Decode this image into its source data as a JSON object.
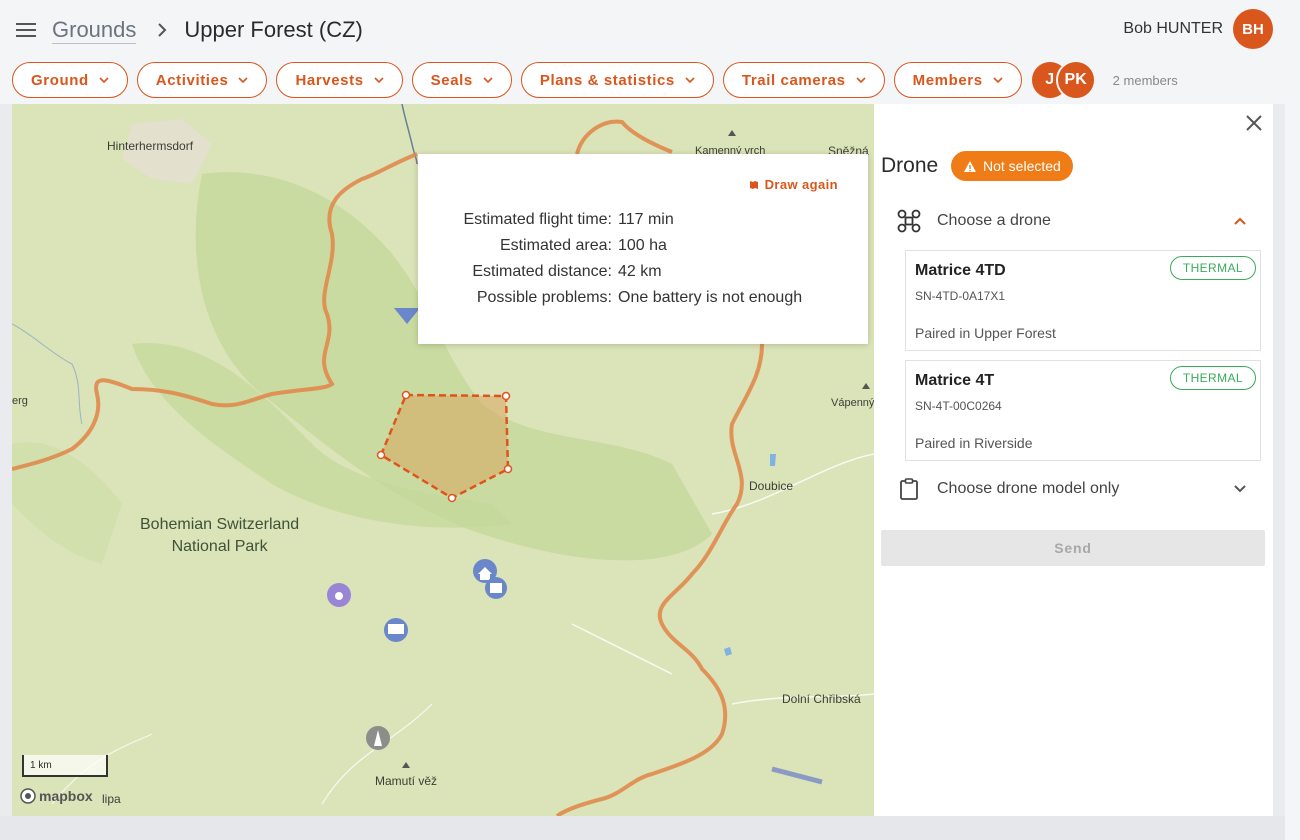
{
  "header": {
    "breadcrumb_root": "Grounds",
    "breadcrumb_current": "Upper Forest (CZ)",
    "user_name": "Bob HUNTER",
    "user_initials": "BH"
  },
  "nav": {
    "items": [
      {
        "label": "Ground"
      },
      {
        "label": "Activities"
      },
      {
        "label": "Harvests"
      },
      {
        "label": "Seals"
      },
      {
        "label": "Plans & statistics"
      },
      {
        "label": "Trail cameras"
      },
      {
        "label": "Members"
      }
    ],
    "member_initials": [
      "J",
      "PK"
    ],
    "members_count": "2 members"
  },
  "map": {
    "labels": {
      "hinterhermsdorf": "Hinterhermsdorf",
      "kamenny": "Kamenný vrch",
      "snezna": "Sněžná",
      "erg": "erg",
      "vapenny": "Vápenný",
      "doubice": "Doubice",
      "dolni": "Dolní Chřibská",
      "mamuti": "Mamutí věž",
      "lipa": "lipa"
    },
    "park_label_line1": "Bohemian Switzerland",
    "park_label_line2": "National Park",
    "scale_label": "1 km",
    "attribution": "mapbox"
  },
  "estimate": {
    "draw_again_label": "Draw again",
    "rows": [
      {
        "key": "Estimated flight time:",
        "value": "117 min"
      },
      {
        "key": "Estimated area:",
        "value": "100 ha"
      },
      {
        "key": "Estimated distance:",
        "value": "42 km"
      },
      {
        "key": "Possible problems:",
        "value": "One battery is not enough"
      }
    ]
  },
  "panel": {
    "title": "Drone",
    "status": "Not selected",
    "choose_drone_label": "Choose a drone",
    "drones": [
      {
        "name": "Matrice 4TD",
        "serial": "SN-4TD-0A17X1",
        "paired": "Paired in Upper Forest",
        "tag": "THERMAL"
      },
      {
        "name": "Matrice 4T",
        "serial": "SN-4T-00C0264",
        "paired": "Paired in Riverside",
        "tag": "THERMAL"
      }
    ],
    "choose_model_label": "Choose drone model only",
    "send_label": "Send"
  },
  "colors": {
    "accent": "#d9561c",
    "warning": "#f07c17",
    "thermal": "#3aaa5b",
    "border_line": "#e08a4c"
  }
}
